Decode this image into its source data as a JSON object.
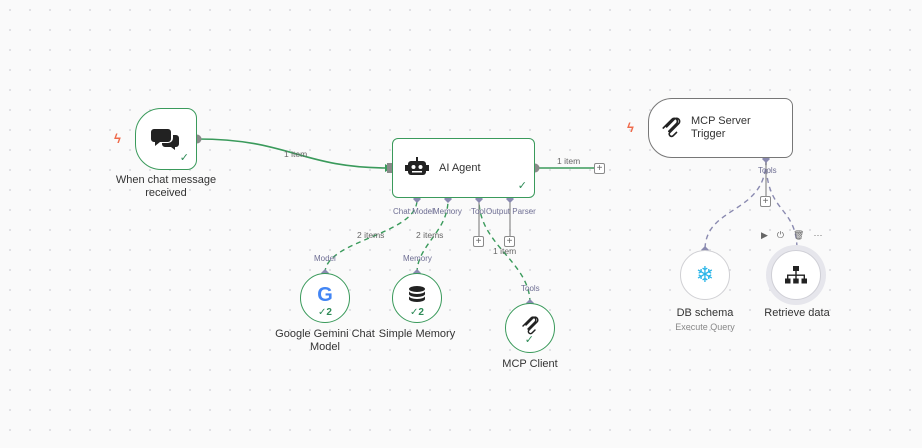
{
  "nodes": {
    "chat_trigger": {
      "title_line1": "When chat message",
      "title_line2": "received"
    },
    "ai_agent": {
      "title": "AI Agent"
    },
    "mcp_server_trigger": {
      "title_line1": "MCP Server",
      "title_line2": "Trigger"
    },
    "gemini": {
      "title_line1": "Google Gemini Chat",
      "title_line2": "Model",
      "count": "2"
    },
    "simple_memory": {
      "title": "Simple Memory",
      "count": "2"
    },
    "mcp_client": {
      "title": "MCP Client"
    },
    "db_schema": {
      "title": "DB schema",
      "subtitle": "Execute Query"
    },
    "retrieve_data": {
      "title": "Retrieve data"
    }
  },
  "connections": {
    "chat_to_agent": "1 item",
    "agent_output": "1 item",
    "gemini_items": "2 items",
    "memory_items": "2 items",
    "tool_items": "1 item"
  },
  "ports": {
    "chat_model": "Chat Model",
    "memory": "Memory",
    "tool": "Tool",
    "output_parser": "Output Parser",
    "model": "Model",
    "memory_in": "Memory",
    "tools_in": "Tools",
    "tools_out": "Tools"
  },
  "toolbar": {
    "run": "▶",
    "power": "⏻",
    "delete": "🗑",
    "more": "···"
  },
  "colors": {
    "accent_green": "#3a9a5b",
    "purple": "#8a8ab0",
    "trigger_bolt": "#ef6a4a"
  }
}
